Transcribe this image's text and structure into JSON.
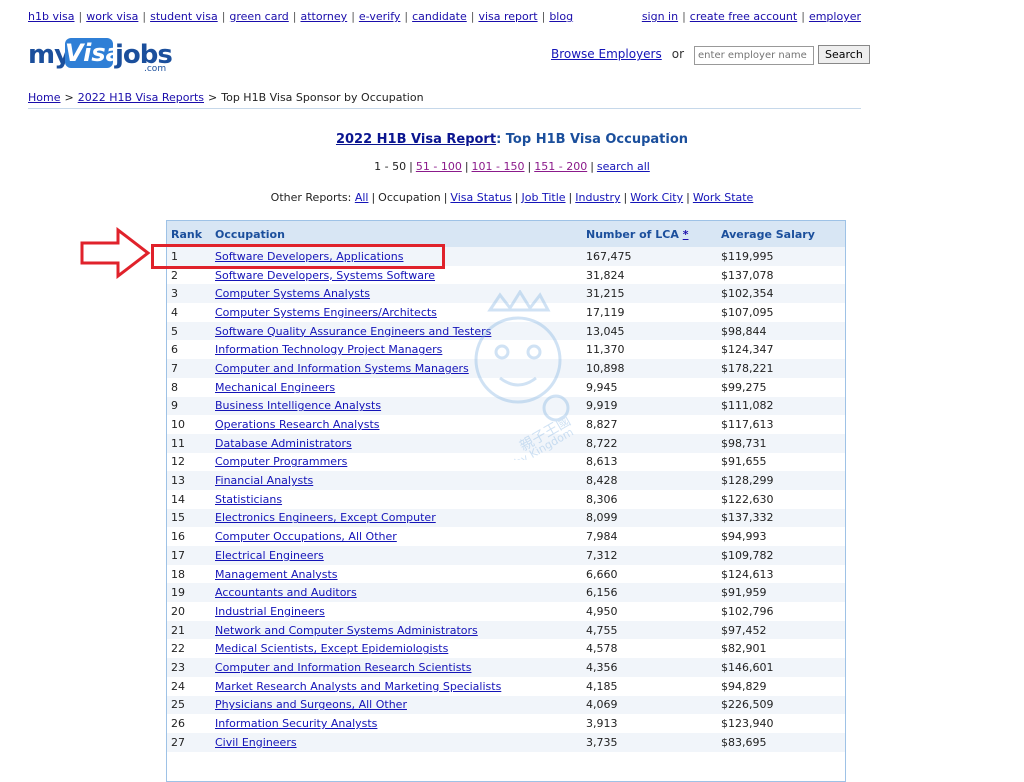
{
  "top_nav": [
    "h1b visa",
    "work visa",
    "student visa",
    "green card",
    "attorney",
    "e-verify",
    "candidate",
    "visa report",
    "blog"
  ],
  "account_nav": [
    "sign in",
    "create free account",
    "employer"
  ],
  "logo": {
    "my": "my",
    "visa": "Visa",
    "jobs": "jobs",
    "com": ".com"
  },
  "search": {
    "browse_label": "Browse Employers",
    "or": "or",
    "placeholder": "enter employer name",
    "button": "Search"
  },
  "breadcrumb": {
    "home": "Home",
    "reports": "2022 H1B Visa Reports",
    "current": "Top H1B Visa Sponsor by Occupation"
  },
  "title": {
    "link": "2022 H1B Visa Report",
    "rest": ": Top H1B Visa Occupation"
  },
  "pager": {
    "current": "1 - 50",
    "links": [
      "51 - 100",
      "101 - 150",
      "151 - 200"
    ],
    "search_all": "search all"
  },
  "other_reports": {
    "label": "Other Reports:",
    "all": "All",
    "current": "Occupation",
    "links": [
      "Visa Status",
      "Job Title",
      "Industry",
      "Work City",
      "Work State"
    ]
  },
  "table": {
    "headers": {
      "rank": "Rank",
      "occupation": "Occupation",
      "lca": "Number of LCA",
      "lca_mark": "*",
      "salary": "Average Salary"
    },
    "rows": [
      [
        "1",
        "Software Developers, Applications",
        "167,475",
        "$119,995"
      ],
      [
        "2",
        "Software Developers, Systems Software",
        "31,824",
        "$137,078"
      ],
      [
        "3",
        "Computer Systems Analysts",
        "31,215",
        "$102,354"
      ],
      [
        "4",
        "Computer Systems Engineers/Architects",
        "17,119",
        "$107,095"
      ],
      [
        "5",
        "Software Quality Assurance Engineers and Testers",
        "13,045",
        "$98,844"
      ],
      [
        "6",
        "Information Technology Project Managers",
        "11,370",
        "$124,347"
      ],
      [
        "7",
        "Computer and Information Systems Managers",
        "10,898",
        "$178,221"
      ],
      [
        "8",
        "Mechanical Engineers",
        "9,945",
        "$99,275"
      ],
      [
        "9",
        "Business Intelligence Analysts",
        "9,919",
        "$111,082"
      ],
      [
        "10",
        "Operations Research Analysts",
        "8,827",
        "$117,613"
      ],
      [
        "11",
        "Database Administrators",
        "8,722",
        "$98,731"
      ],
      [
        "12",
        "Computer Programmers",
        "8,613",
        "$91,655"
      ],
      [
        "13",
        "Financial Analysts",
        "8,428",
        "$128,299"
      ],
      [
        "14",
        "Statisticians",
        "8,306",
        "$122,630"
      ],
      [
        "15",
        "Electronics Engineers, Except Computer",
        "8,099",
        "$137,332"
      ],
      [
        "16",
        "Computer Occupations, All Other",
        "7,984",
        "$94,993"
      ],
      [
        "17",
        "Electrical Engineers",
        "7,312",
        "$109,782"
      ],
      [
        "18",
        "Management Analysts",
        "6,660",
        "$124,613"
      ],
      [
        "19",
        "Accountants and Auditors",
        "6,156",
        "$91,959"
      ],
      [
        "20",
        "Industrial Engineers",
        "4,950",
        "$102,796"
      ],
      [
        "21",
        "Network and Computer Systems Administrators",
        "4,755",
        "$97,452"
      ],
      [
        "22",
        "Medical Scientists, Except Epidemiologists",
        "4,578",
        "$82,901"
      ],
      [
        "23",
        "Computer and Information Research Scientists",
        "4,356",
        "$146,601"
      ],
      [
        "24",
        "Market Research Analysts and Marketing Specialists",
        "4,185",
        "$94,829"
      ],
      [
        "25",
        "Physicians and Surgeons, All Other",
        "4,069",
        "$226,509"
      ],
      [
        "26",
        "Information Security Analysts",
        "3,913",
        "$123,940"
      ],
      [
        "27",
        "Civil Engineers",
        "3,735",
        "$83,695"
      ]
    ]
  },
  "watermark": {
    "cn": "親子王國",
    "en": "Baby Kingdom"
  },
  "colors": {
    "link": "#1414b8",
    "visited": "#8b1a8b",
    "header_bg": "#d8e6f4",
    "highlight": "#e0222b"
  }
}
